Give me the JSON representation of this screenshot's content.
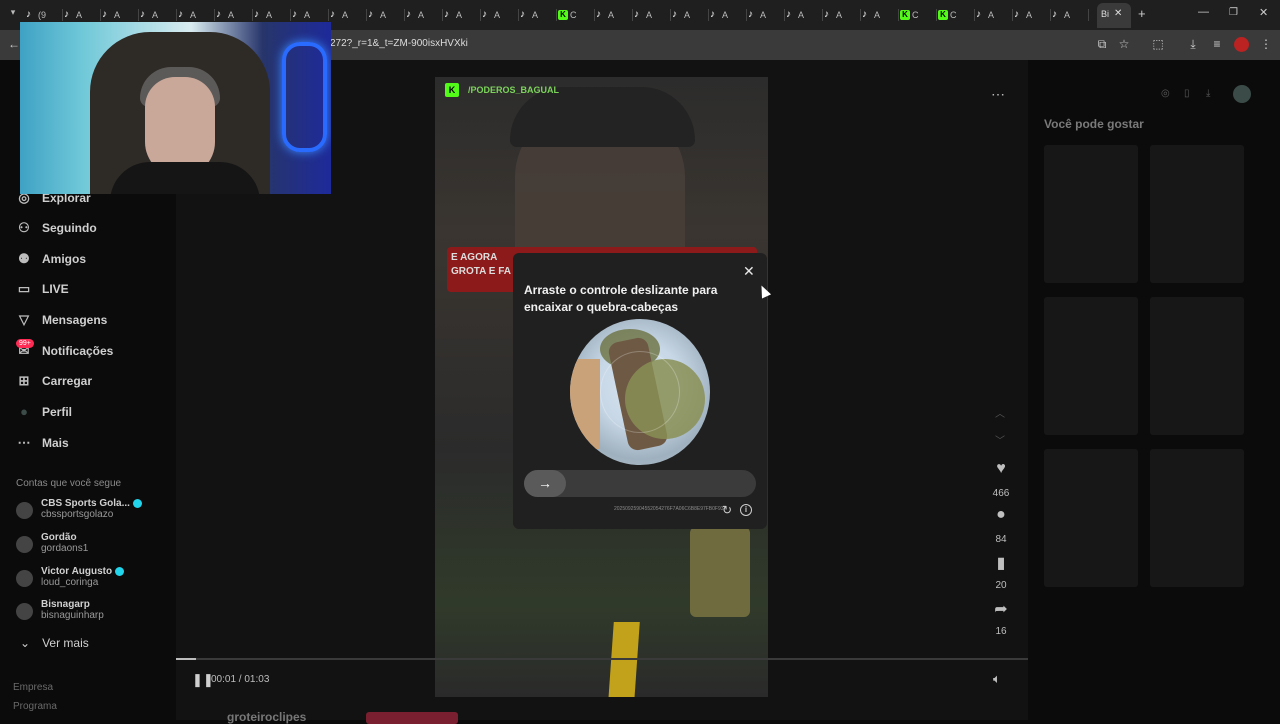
{
  "browser": {
    "tab_labels": [
      "(9",
      "A",
      "A",
      "A",
      "A",
      "A",
      "A",
      "A",
      "A",
      "A",
      "A",
      "A",
      "A",
      "A",
      "C",
      "A",
      "A",
      "A",
      "A",
      "A",
      "A",
      "A",
      "A",
      "C",
      "C",
      "A",
      "A",
      "A"
    ],
    "active_tab_label": "Bi",
    "url": "272?_r=1&_t=ZM-900isxHVXki"
  },
  "sidebar": {
    "items": [
      {
        "label": "Explorar",
        "icon": "compass-icon"
      },
      {
        "label": "Seguindo",
        "icon": "user-follow-icon"
      },
      {
        "label": "Amigos",
        "icon": "friends-icon"
      },
      {
        "label": "LIVE",
        "icon": "live-icon"
      },
      {
        "label": "Mensagens",
        "icon": "messages-icon"
      },
      {
        "label": "Notificações",
        "icon": "notifications-icon"
      },
      {
        "label": "Carregar",
        "icon": "upload-icon"
      },
      {
        "label": "Perfil",
        "icon": "profile-avatar"
      },
      {
        "label": "Mais",
        "icon": "more-icon"
      }
    ],
    "notification_badge": "99+",
    "following_header": "Contas que você segue",
    "accounts": [
      {
        "name": "CBS Sports Gola...",
        "username": "cbssportsgolazo",
        "verified": true
      },
      {
        "name": "Gordão",
        "username": "gordaons1",
        "verified": false
      },
      {
        "name": "Victor Augusto",
        "username": "loud_coringa",
        "verified": true
      },
      {
        "name": "Bisnagarp",
        "username": "bisnaguinharp",
        "verified": false
      }
    ],
    "see_more": "Ver mais",
    "footer": [
      "Empresa",
      "Programa"
    ]
  },
  "video": {
    "channel": "/PODEROS_BAGUAL",
    "overlay_text_line1": "E AGORA",
    "overlay_text_line2": "GROTA E FA",
    "time": "00:01 / 01:03",
    "progress": 0.023,
    "likes": "466",
    "comments": "84",
    "saves": "20",
    "shares": "16",
    "below_name": "groteiroclipes"
  },
  "captcha": {
    "title": "Arraste o controle deslizante para encaixar o quebra-cabeças",
    "id": "20250925904552054276F7A06C6B8E97FB0F93"
  },
  "right_panel": {
    "title": "Você pode gostar"
  },
  "colors": {
    "accent": "#fe2c55",
    "kick_green": "#53fc18",
    "verified": "#20d5ec"
  }
}
